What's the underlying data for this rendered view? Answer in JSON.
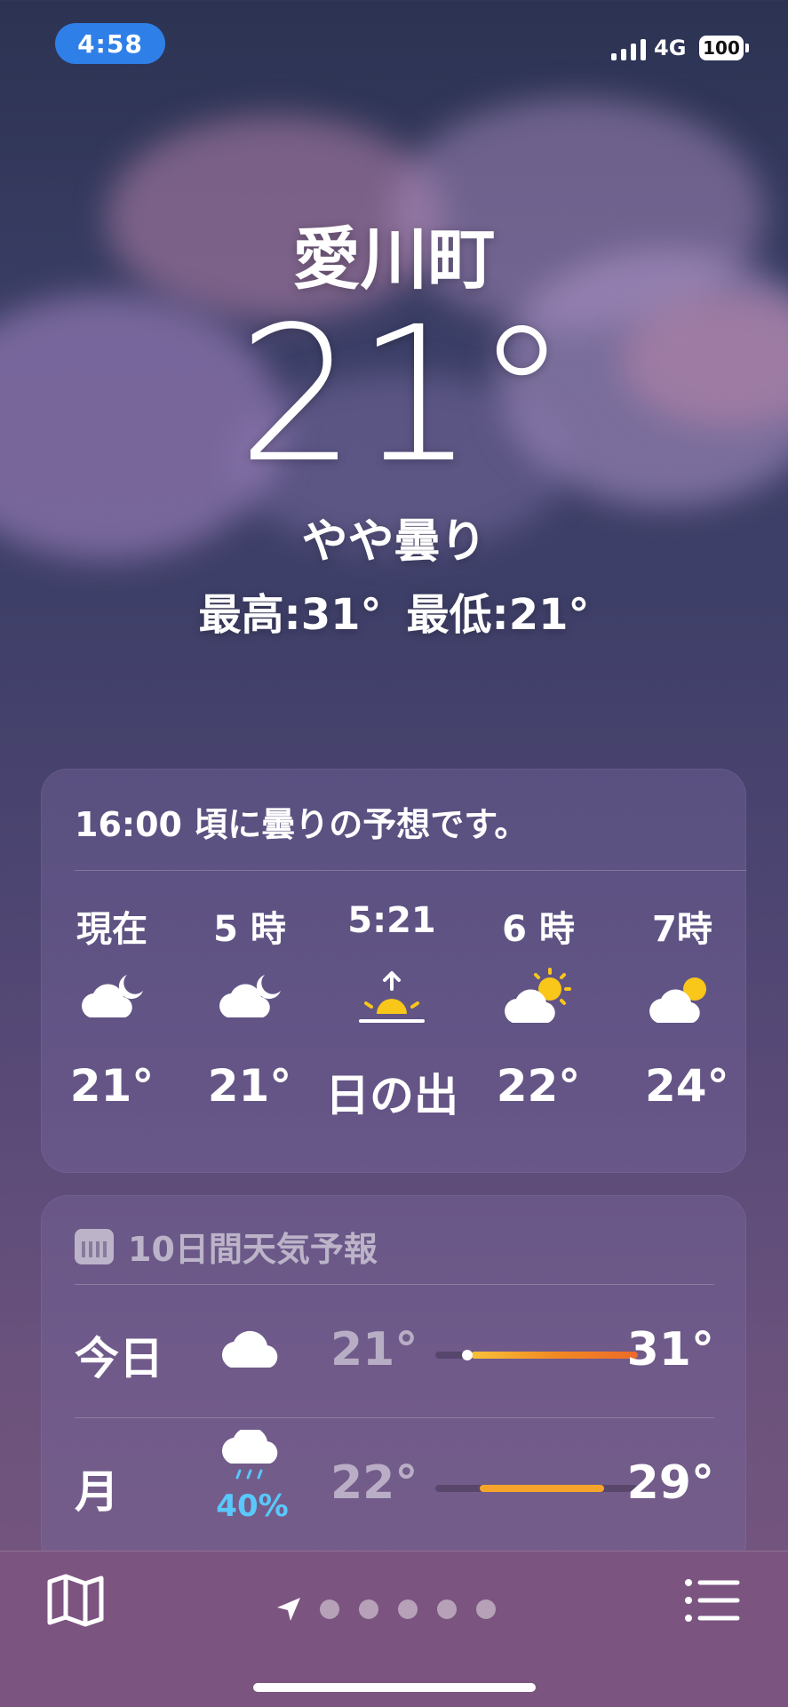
{
  "status_bar": {
    "time": "4:58",
    "network": "4G",
    "battery": "100"
  },
  "location": "愛川町",
  "current": {
    "temp": "21°",
    "condition": "やや曇り",
    "high": "最高:31°",
    "low": "最低:21°"
  },
  "hourly": {
    "summary": "16:00 頃に曇りの予想です。",
    "items": [
      {
        "time": "現在",
        "icon": "moon-cloud-icon",
        "temp": "21°"
      },
      {
        "time": "5 時",
        "icon": "moon-cloud-icon",
        "temp": "21°"
      },
      {
        "time": "5:21",
        "icon": "sunrise-icon",
        "temp": "日の出"
      },
      {
        "time": "6 時",
        "icon": "sun-cloud-icon",
        "temp": "22°"
      },
      {
        "time": "7時",
        "icon": "sun-cloud-icon",
        "temp": "24°"
      }
    ]
  },
  "daily": {
    "title": "10日間天気予報",
    "rows": [
      {
        "day": "今日",
        "icon": "cloud-icon",
        "pop": "",
        "low": "21°",
        "high": "31°"
      },
      {
        "day": "月",
        "icon": "rain-cloud-icon",
        "pop": "40%",
        "low": "22°",
        "high": "29°"
      }
    ]
  },
  "bottom": {
    "pages": 5,
    "current_page": 0
  },
  "colors": {
    "accent_blue": "#2f7fe8",
    "precip": "#5ac8fa",
    "temp_bar_start": "#f7c23a",
    "temp_bar_end": "#ec6a2a",
    "sun": "#f9c61a"
  }
}
